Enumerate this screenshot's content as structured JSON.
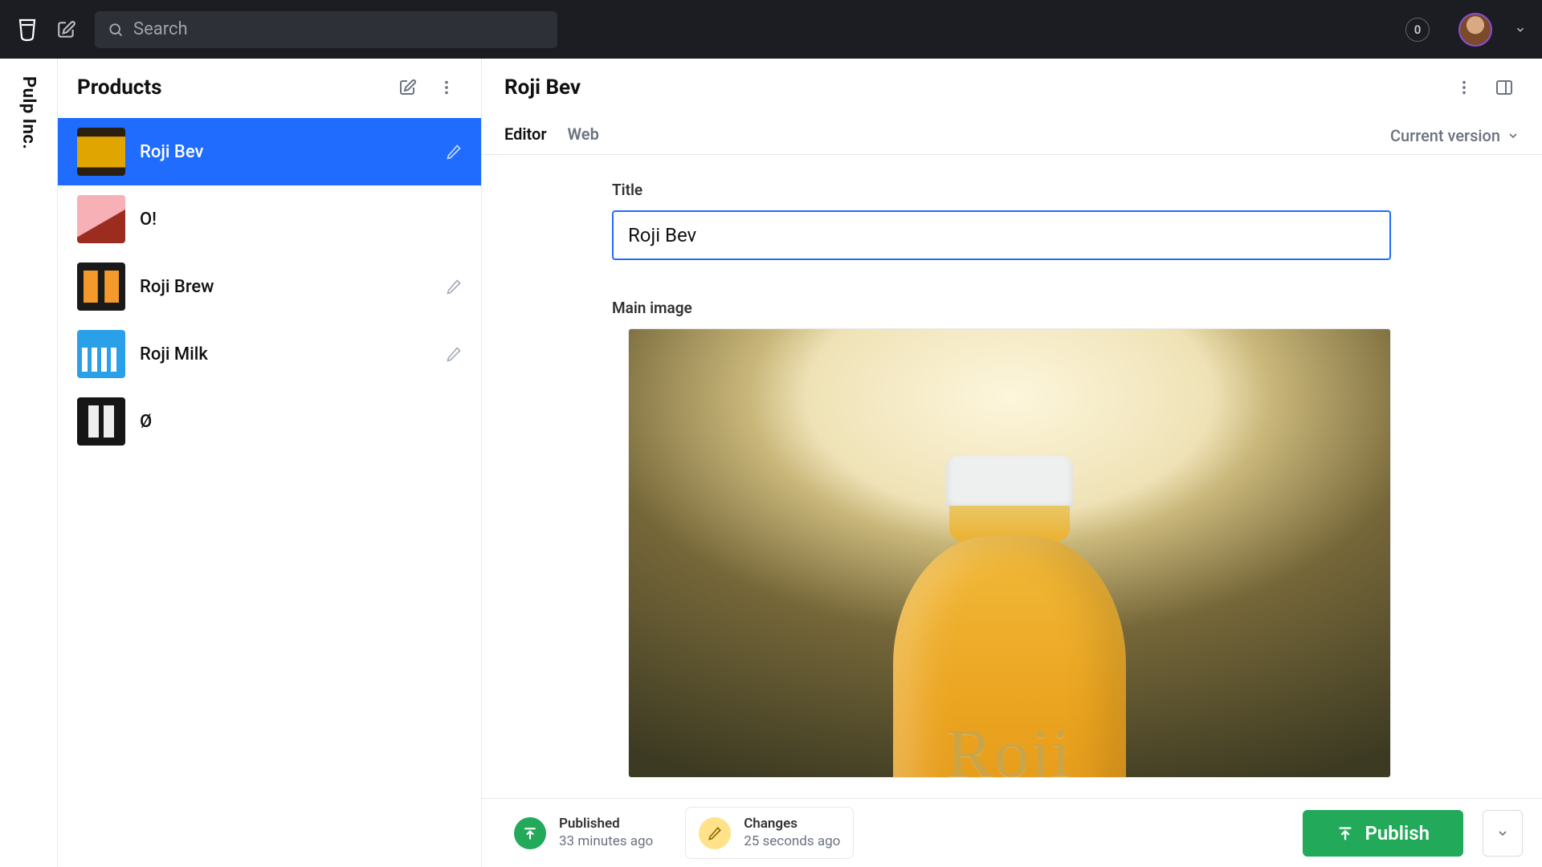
{
  "topbar": {
    "search_placeholder": "Search",
    "notification_count": "0"
  },
  "org": {
    "name": "Pulp Inc."
  },
  "list": {
    "title": "Products",
    "items": [
      {
        "name": "Roji Bev",
        "selected": true,
        "editable": true
      },
      {
        "name": "O!",
        "selected": false,
        "editable": false
      },
      {
        "name": "Roji Brew",
        "selected": false,
        "editable": true
      },
      {
        "name": "Roji Milk",
        "selected": false,
        "editable": true
      },
      {
        "name": "Ø",
        "selected": false,
        "editable": false
      }
    ]
  },
  "editor": {
    "title": "Roji Bev",
    "tabs": {
      "editor": "Editor",
      "web": "Web"
    },
    "version_label": "Current version",
    "fields": {
      "title_label": "Title",
      "title_value": "Roji Bev",
      "main_image_label": "Main image"
    }
  },
  "status": {
    "published": {
      "label": "Published",
      "time": "33 minutes ago"
    },
    "changes": {
      "label": "Changes",
      "time": "25 seconds ago"
    },
    "publish_button": "Publish"
  }
}
